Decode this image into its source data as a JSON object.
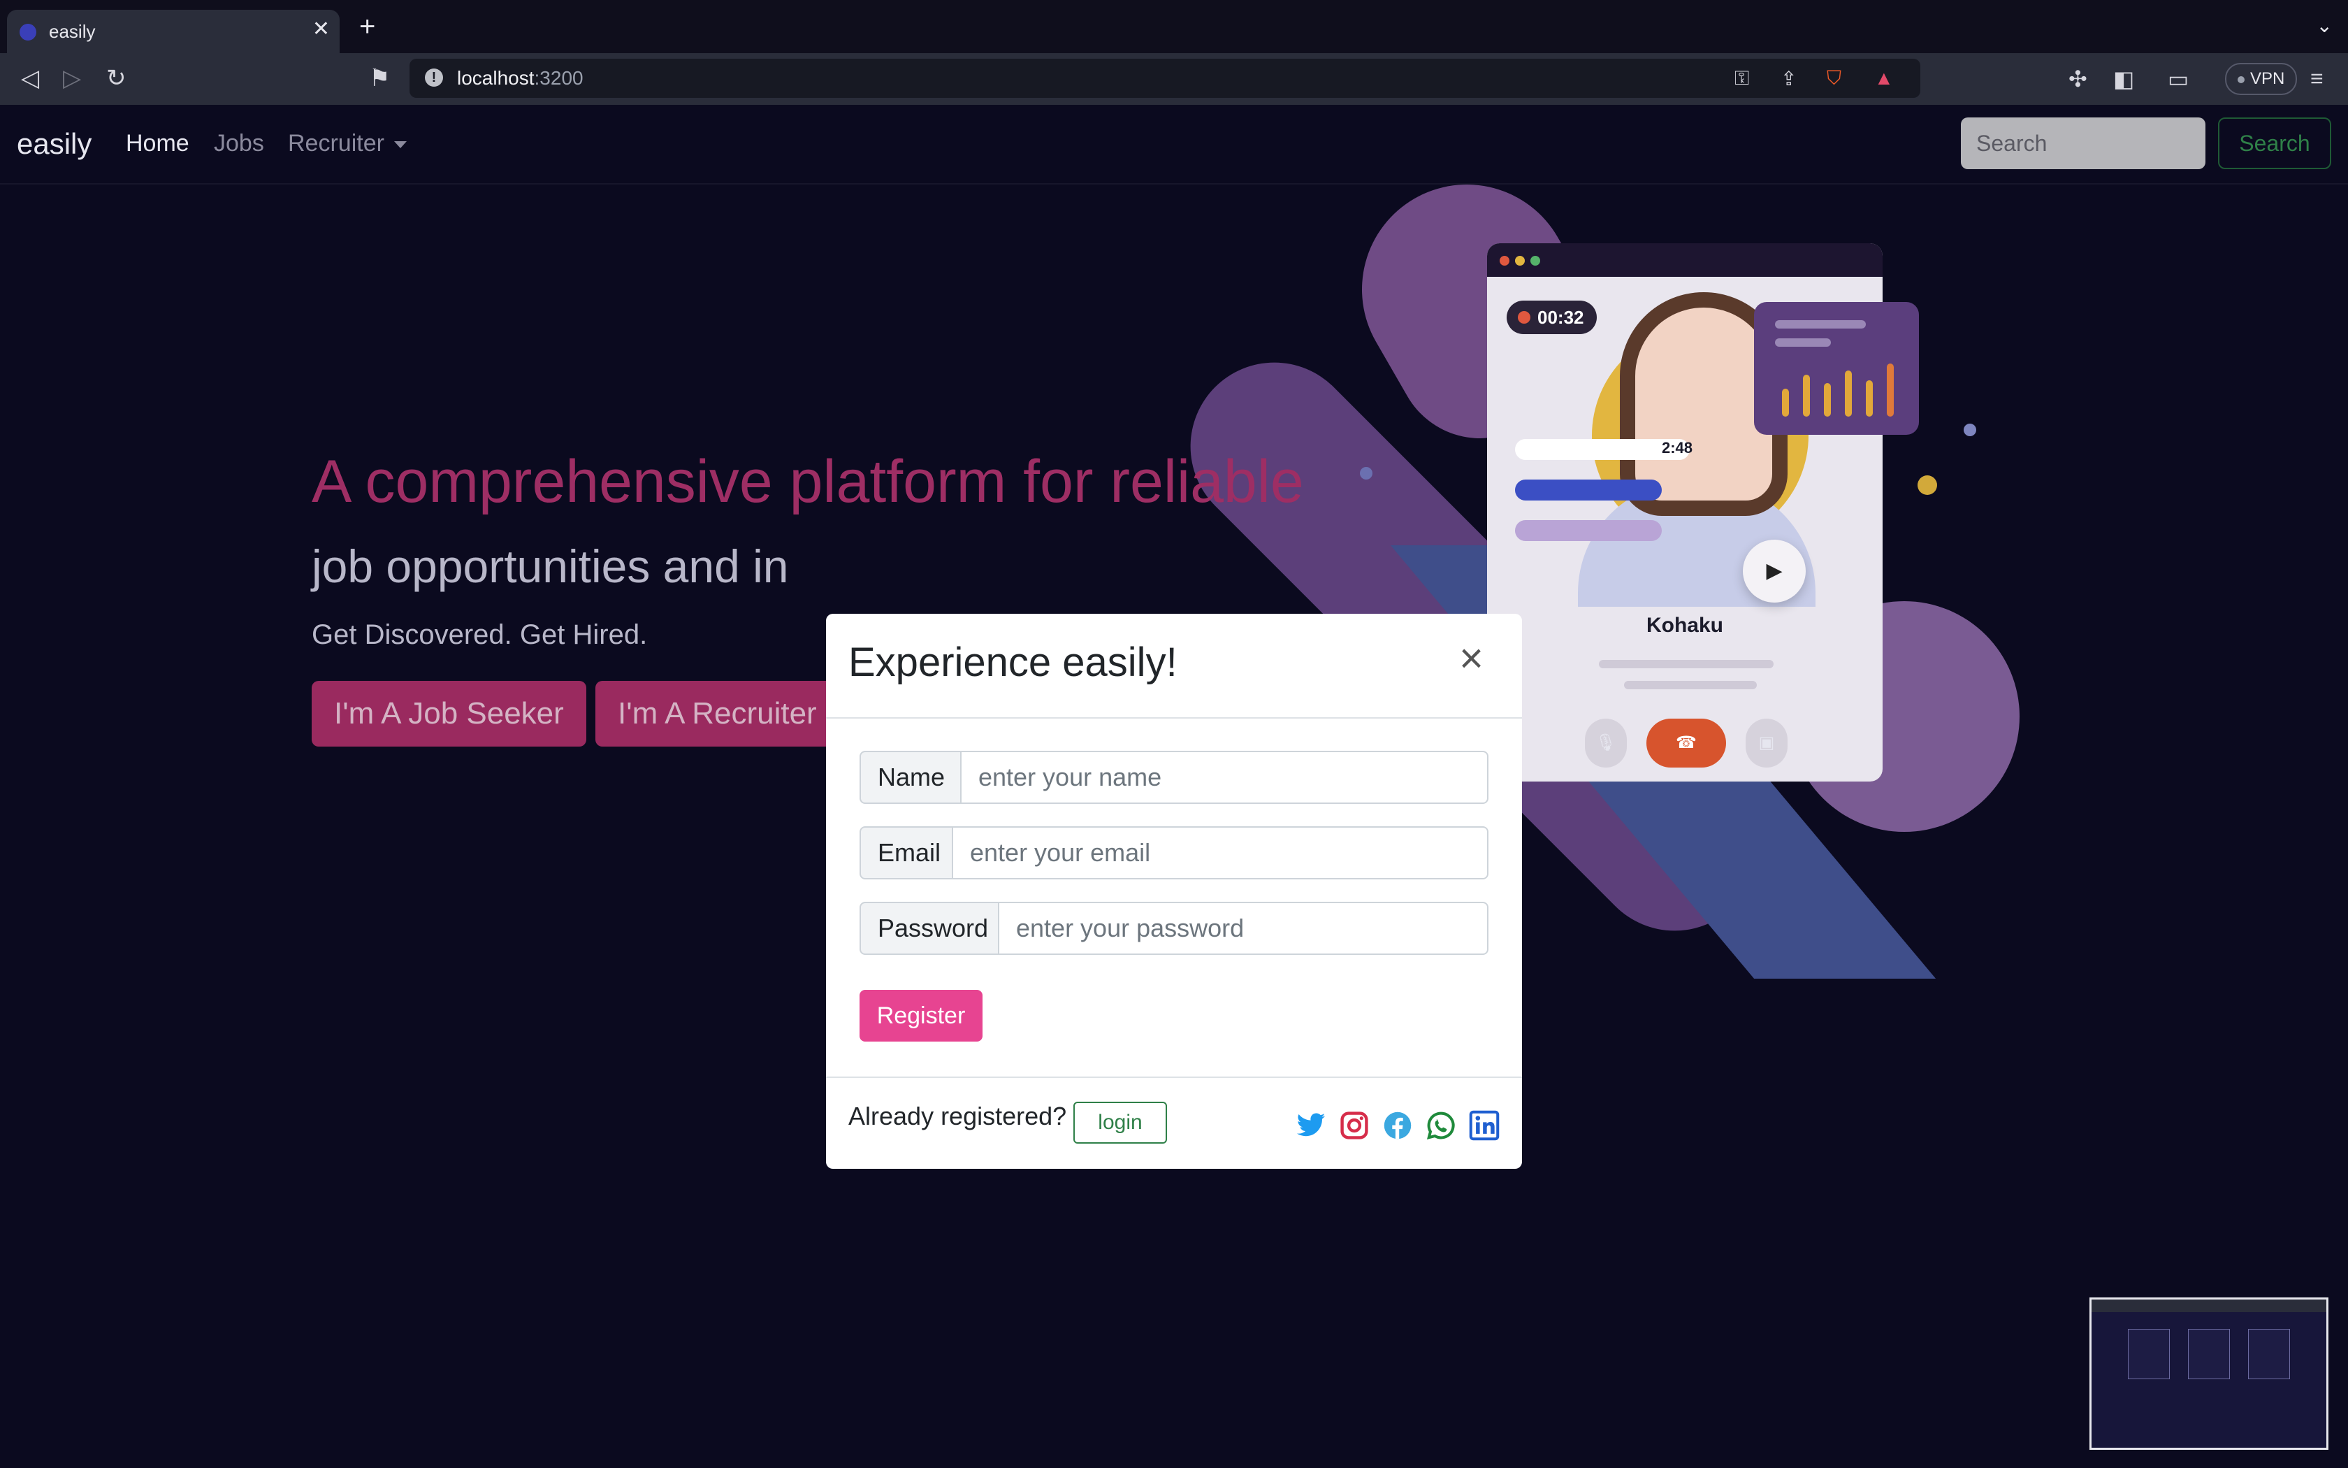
{
  "browser": {
    "tab_title": "easily",
    "url_host": "localhost",
    "url_port": ":3200",
    "vpn_label": "VPN"
  },
  "navbar": {
    "brand": "easily",
    "links": [
      "Home",
      "Jobs",
      "Recruiter"
    ],
    "search_placeholder": "Search",
    "search_button": "Search"
  },
  "hero": {
    "headline": "A comprehensive platform for reliable",
    "headline_line2": "job opportunities and in",
    "tagline": "Get Discovered. Get Hired.",
    "job_seeker_button": "I'm A Job Seeker",
    "recruiter_button": "I'm A Recruiter"
  },
  "illustration": {
    "timer": "00:32",
    "chip_time": "2:48",
    "caller_name": "Kohaku"
  },
  "modal": {
    "title": "Experience easily!",
    "close_symbol": "×",
    "fields": [
      {
        "label": "Name",
        "placeholder": "enter your name"
      },
      {
        "label": "Email",
        "placeholder": "enter your email"
      },
      {
        "label": "Password",
        "placeholder": "enter your password"
      }
    ],
    "register_button": "Register",
    "footer_text": "Already registered?",
    "login_button": "login",
    "social_icons": [
      "twitter-icon",
      "instagram-icon",
      "facebook-icon",
      "whatsapp-icon",
      "linkedin-icon"
    ]
  },
  "colors": {
    "page_bg": "#0b0a1f",
    "accent_pink": "#e74491",
    "hero_pink": "#9e2e64",
    "success_green": "#2f8048"
  }
}
